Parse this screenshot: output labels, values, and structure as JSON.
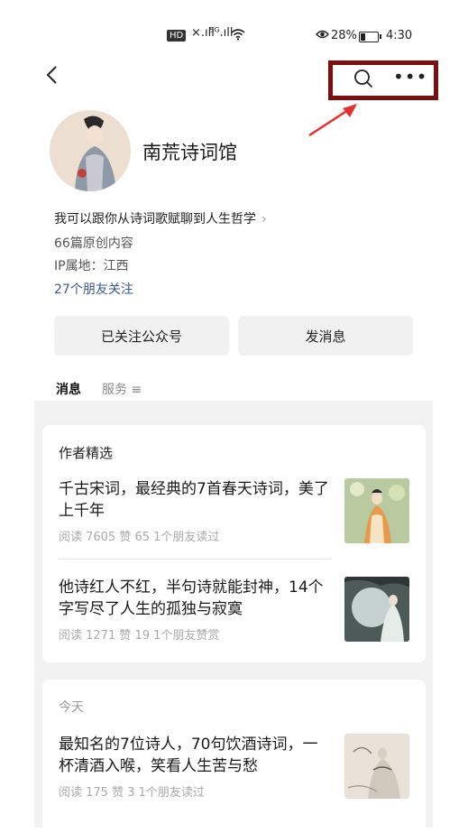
{
  "status_bar": {
    "hd": "HD",
    "signal1": "×.ıll",
    "signal2": "⁵ᴳ.ıll",
    "battery": "28%",
    "time": "4:30"
  },
  "account": {
    "name": "南荒诗词馆",
    "intro": "我可以跟你从诗词歌赋聊到人生哲学",
    "original_count": "66篇原创内容",
    "ip": "IP属地：江西",
    "friends_following": "27个朋友关注"
  },
  "actions": {
    "follow_label": "已关注公众号",
    "message_label": "发消息"
  },
  "tabs": [
    {
      "label": "消息"
    },
    {
      "label": "服务 ≡"
    }
  ],
  "feed": {
    "featured": {
      "title": "作者精选",
      "articles": [
        {
          "title": "千古宋词，最经典的7首春天诗词，美了上千年",
          "meta": "阅读 7605  赞 65  1个朋友读过",
          "thumb_icon": "lady-painting-thumbnail"
        },
        {
          "title": "他诗红人不红，半句诗就能封神，14个字写尽了人生的孤独与寂寞",
          "meta": "阅读 1271  赞 19  1个朋友赞赏",
          "thumb_icon": "moon-lady-thumbnail"
        }
      ]
    },
    "today": {
      "title": "今天",
      "articles": [
        {
          "title": "最知名的7位诗人，70句饮酒诗词，一杯清酒入喉，笑看人生苦与愁",
          "meta": "阅读 175  赞 3  1个朋友读过",
          "thumb_icon": "poet-ink-thumbnail"
        }
      ]
    }
  },
  "colors": {
    "highlight_box": "#7b0f0f",
    "arrow": "#e8302b",
    "link": "#3a5a8c"
  }
}
